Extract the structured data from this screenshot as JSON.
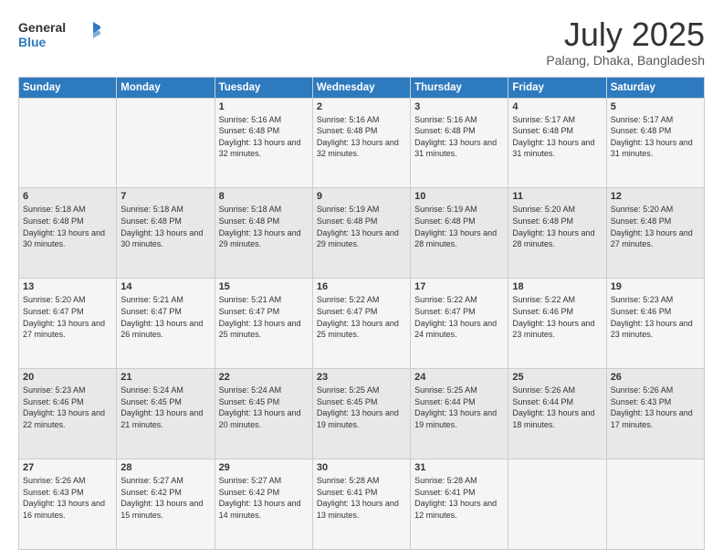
{
  "logo": {
    "line1": "General",
    "line2": "Blue"
  },
  "header": {
    "month": "July 2025",
    "location": "Palang, Dhaka, Bangladesh"
  },
  "weekdays": [
    "Sunday",
    "Monday",
    "Tuesday",
    "Wednesday",
    "Thursday",
    "Friday",
    "Saturday"
  ],
  "weeks": [
    [
      {
        "day": "",
        "info": ""
      },
      {
        "day": "",
        "info": ""
      },
      {
        "day": "1",
        "info": "Sunrise: 5:16 AM\nSunset: 6:48 PM\nDaylight: 13 hours and 32 minutes."
      },
      {
        "day": "2",
        "info": "Sunrise: 5:16 AM\nSunset: 6:48 PM\nDaylight: 13 hours and 32 minutes."
      },
      {
        "day": "3",
        "info": "Sunrise: 5:16 AM\nSunset: 6:48 PM\nDaylight: 13 hours and 31 minutes."
      },
      {
        "day": "4",
        "info": "Sunrise: 5:17 AM\nSunset: 6:48 PM\nDaylight: 13 hours and 31 minutes."
      },
      {
        "day": "5",
        "info": "Sunrise: 5:17 AM\nSunset: 6:48 PM\nDaylight: 13 hours and 31 minutes."
      }
    ],
    [
      {
        "day": "6",
        "info": "Sunrise: 5:18 AM\nSunset: 6:48 PM\nDaylight: 13 hours and 30 minutes."
      },
      {
        "day": "7",
        "info": "Sunrise: 5:18 AM\nSunset: 6:48 PM\nDaylight: 13 hours and 30 minutes."
      },
      {
        "day": "8",
        "info": "Sunrise: 5:18 AM\nSunset: 6:48 PM\nDaylight: 13 hours and 29 minutes."
      },
      {
        "day": "9",
        "info": "Sunrise: 5:19 AM\nSunset: 6:48 PM\nDaylight: 13 hours and 29 minutes."
      },
      {
        "day": "10",
        "info": "Sunrise: 5:19 AM\nSunset: 6:48 PM\nDaylight: 13 hours and 28 minutes."
      },
      {
        "day": "11",
        "info": "Sunrise: 5:20 AM\nSunset: 6:48 PM\nDaylight: 13 hours and 28 minutes."
      },
      {
        "day": "12",
        "info": "Sunrise: 5:20 AM\nSunset: 6:48 PM\nDaylight: 13 hours and 27 minutes."
      }
    ],
    [
      {
        "day": "13",
        "info": "Sunrise: 5:20 AM\nSunset: 6:47 PM\nDaylight: 13 hours and 27 minutes."
      },
      {
        "day": "14",
        "info": "Sunrise: 5:21 AM\nSunset: 6:47 PM\nDaylight: 13 hours and 26 minutes."
      },
      {
        "day": "15",
        "info": "Sunrise: 5:21 AM\nSunset: 6:47 PM\nDaylight: 13 hours and 25 minutes."
      },
      {
        "day": "16",
        "info": "Sunrise: 5:22 AM\nSunset: 6:47 PM\nDaylight: 13 hours and 25 minutes."
      },
      {
        "day": "17",
        "info": "Sunrise: 5:22 AM\nSunset: 6:47 PM\nDaylight: 13 hours and 24 minutes."
      },
      {
        "day": "18",
        "info": "Sunrise: 5:22 AM\nSunset: 6:46 PM\nDaylight: 13 hours and 23 minutes."
      },
      {
        "day": "19",
        "info": "Sunrise: 5:23 AM\nSunset: 6:46 PM\nDaylight: 13 hours and 23 minutes."
      }
    ],
    [
      {
        "day": "20",
        "info": "Sunrise: 5:23 AM\nSunset: 6:46 PM\nDaylight: 13 hours and 22 minutes."
      },
      {
        "day": "21",
        "info": "Sunrise: 5:24 AM\nSunset: 6:45 PM\nDaylight: 13 hours and 21 minutes."
      },
      {
        "day": "22",
        "info": "Sunrise: 5:24 AM\nSunset: 6:45 PM\nDaylight: 13 hours and 20 minutes."
      },
      {
        "day": "23",
        "info": "Sunrise: 5:25 AM\nSunset: 6:45 PM\nDaylight: 13 hours and 19 minutes."
      },
      {
        "day": "24",
        "info": "Sunrise: 5:25 AM\nSunset: 6:44 PM\nDaylight: 13 hours and 19 minutes."
      },
      {
        "day": "25",
        "info": "Sunrise: 5:26 AM\nSunset: 6:44 PM\nDaylight: 13 hours and 18 minutes."
      },
      {
        "day": "26",
        "info": "Sunrise: 5:26 AM\nSunset: 6:43 PM\nDaylight: 13 hours and 17 minutes."
      }
    ],
    [
      {
        "day": "27",
        "info": "Sunrise: 5:26 AM\nSunset: 6:43 PM\nDaylight: 13 hours and 16 minutes."
      },
      {
        "day": "28",
        "info": "Sunrise: 5:27 AM\nSunset: 6:42 PM\nDaylight: 13 hours and 15 minutes."
      },
      {
        "day": "29",
        "info": "Sunrise: 5:27 AM\nSunset: 6:42 PM\nDaylight: 13 hours and 14 minutes."
      },
      {
        "day": "30",
        "info": "Sunrise: 5:28 AM\nSunset: 6:41 PM\nDaylight: 13 hours and 13 minutes."
      },
      {
        "day": "31",
        "info": "Sunrise: 5:28 AM\nSunset: 6:41 PM\nDaylight: 13 hours and 12 minutes."
      },
      {
        "day": "",
        "info": ""
      },
      {
        "day": "",
        "info": ""
      }
    ]
  ]
}
